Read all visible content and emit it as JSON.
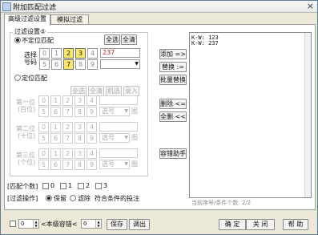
{
  "window": {
    "title": "附加匹配过滤",
    "close": "×"
  },
  "tabs": [
    {
      "label": "高级过滤设置"
    },
    {
      "label": "模拟过滤"
    }
  ],
  "filter_settings": {
    "group_title": "过滤设置⑤",
    "unordered": {
      "label": "不定位匹配",
      "selectall": "全选",
      "clear": "全清",
      "side_label_1": "选择",
      "side_label_2": "号码",
      "row1": [
        "0",
        "1",
        "2",
        "3",
        "4"
      ],
      "row2": [
        "5",
        "6",
        "7",
        "8",
        "9"
      ],
      "selected": [
        "2",
        "3",
        "7"
      ],
      "input_value": "237"
    },
    "positional": {
      "label": "定位匹配",
      "buttons": [
        "全选",
        "全清",
        "机选",
        "录入"
      ],
      "digit_row1": [
        "0",
        "1",
        "2",
        "3",
        "4"
      ],
      "digit_row2": [
        "5",
        "6",
        "7",
        "8",
        "9"
      ],
      "groups": [
        {
          "title": "第一位",
          "sub": "(百位)",
          "select_value": "选号",
          "icon_label": "图"
        },
        {
          "title": "第二位",
          "sub": "(十位)",
          "select_value": "选号",
          "icon_label": "图"
        },
        {
          "title": "第三位",
          "sub": "(个位)",
          "select_value": "选号",
          "icon_label": "图"
        }
      ]
    }
  },
  "match_count": {
    "label": "[匹配个数]",
    "options": [
      "0",
      "1",
      "2",
      "3"
    ]
  },
  "filter_action": {
    "label": "[过滤操作]",
    "keep": "保留",
    "filter": "滤除",
    "tail": "符合条件的投注"
  },
  "middle_buttons": {
    "add": "添加 =>",
    "replace": "替换 :=",
    "batch_replace": "批量替换",
    "delete": "删除 <=",
    "delete_all": "全删 <<",
    "helper": "容错助手"
  },
  "list": {
    "rows": [
      [
        "K-W:",
        "123"
      ],
      [
        "K-W:",
        "237"
      ]
    ]
  },
  "status": "当前序号/条件个数: 2/2",
  "bottom": {
    "left_value": "0",
    "range_label": "<本级容错<",
    "right_value": "0",
    "save": "保存",
    "export": "调出",
    "ok": "确 定",
    "close": "关 闭",
    "help": "帮 助"
  }
}
